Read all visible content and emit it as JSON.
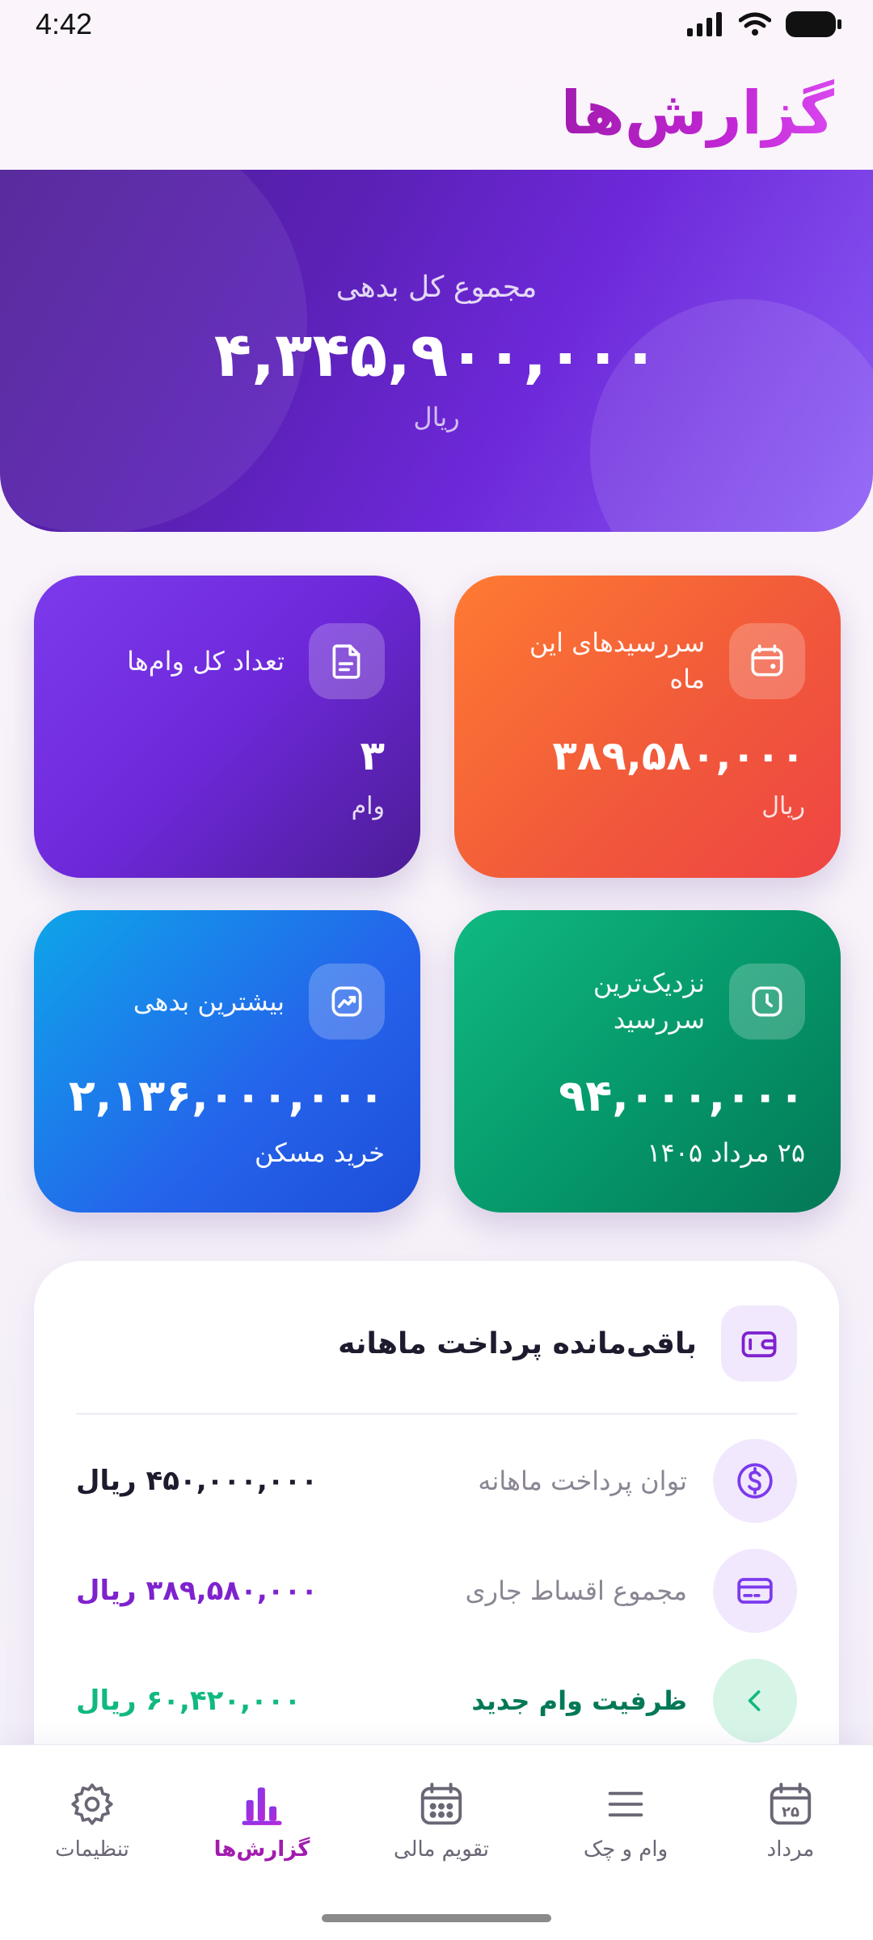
{
  "status_bar": {
    "time": "4:42"
  },
  "header": {
    "title": "گزارش‌ها"
  },
  "hero": {
    "label": "مجموع کل بدهی",
    "amount": "۴,۳۴۵,۹۰۰,۰۰۰",
    "unit": "ریال"
  },
  "cards": {
    "due_this_month": {
      "title": "سررسیدهای این ماه",
      "value": "۳۸۹,۵۸۰,۰۰۰",
      "sub": "ریال",
      "icon": "wallet-icon"
    },
    "total_loans": {
      "title": "تعداد کل وام‌ها",
      "value": "۳",
      "sub": "وام",
      "icon": "document-icon"
    },
    "nearest_due": {
      "title_line1": "نزدیک‌ترین",
      "title_line2": "سررسید",
      "value": "۹۴,۰۰۰,۰۰۰",
      "sub": "۲۵ مرداد ۱۴۰۵",
      "icon": "clock-icon"
    },
    "highest_debt": {
      "title": "بیشترین بدهی",
      "value": "۲,۱۳۶,۰۰۰,۰۰۰",
      "sub": "خرید مسکن",
      "icon": "trend-icon"
    }
  },
  "panel": {
    "title": "باقی‌مانده پرداخت ماهانه",
    "rows": [
      {
        "label": "توان پرداخت ماهانه",
        "value": "۴۵۰,۰۰۰,۰۰۰ ریال",
        "icon": "dollar-icon"
      },
      {
        "label": "مجموع اقساط جاری",
        "value": "۳۸۹,۵۸۰,۰۰۰ ریال",
        "icon": "card-icon"
      },
      {
        "label": "ظرفیت وام جدید",
        "value": "۶۰,۴۲۰,۰۰۰ ریال",
        "icon": "chevron-left-icon"
      }
    ]
  },
  "nav": {
    "items": [
      {
        "label": "مرداد",
        "icon": "calendar-25-icon",
        "day": "۲۵"
      },
      {
        "label": "وام و چک",
        "icon": "menu-icon"
      },
      {
        "label": "تقویم مالی",
        "icon": "calendar-icon"
      },
      {
        "label": "گزارش‌ها",
        "icon": "bar-chart-icon",
        "active": true
      },
      {
        "label": "تنظیمات",
        "icon": "gear-icon"
      }
    ]
  },
  "colors": {
    "brand": "#a21caf",
    "hero": "#5b21b6",
    "orange": "#f15a3a",
    "purple": "#6d28d9",
    "green": "#059669",
    "blue": "#2563eb"
  }
}
